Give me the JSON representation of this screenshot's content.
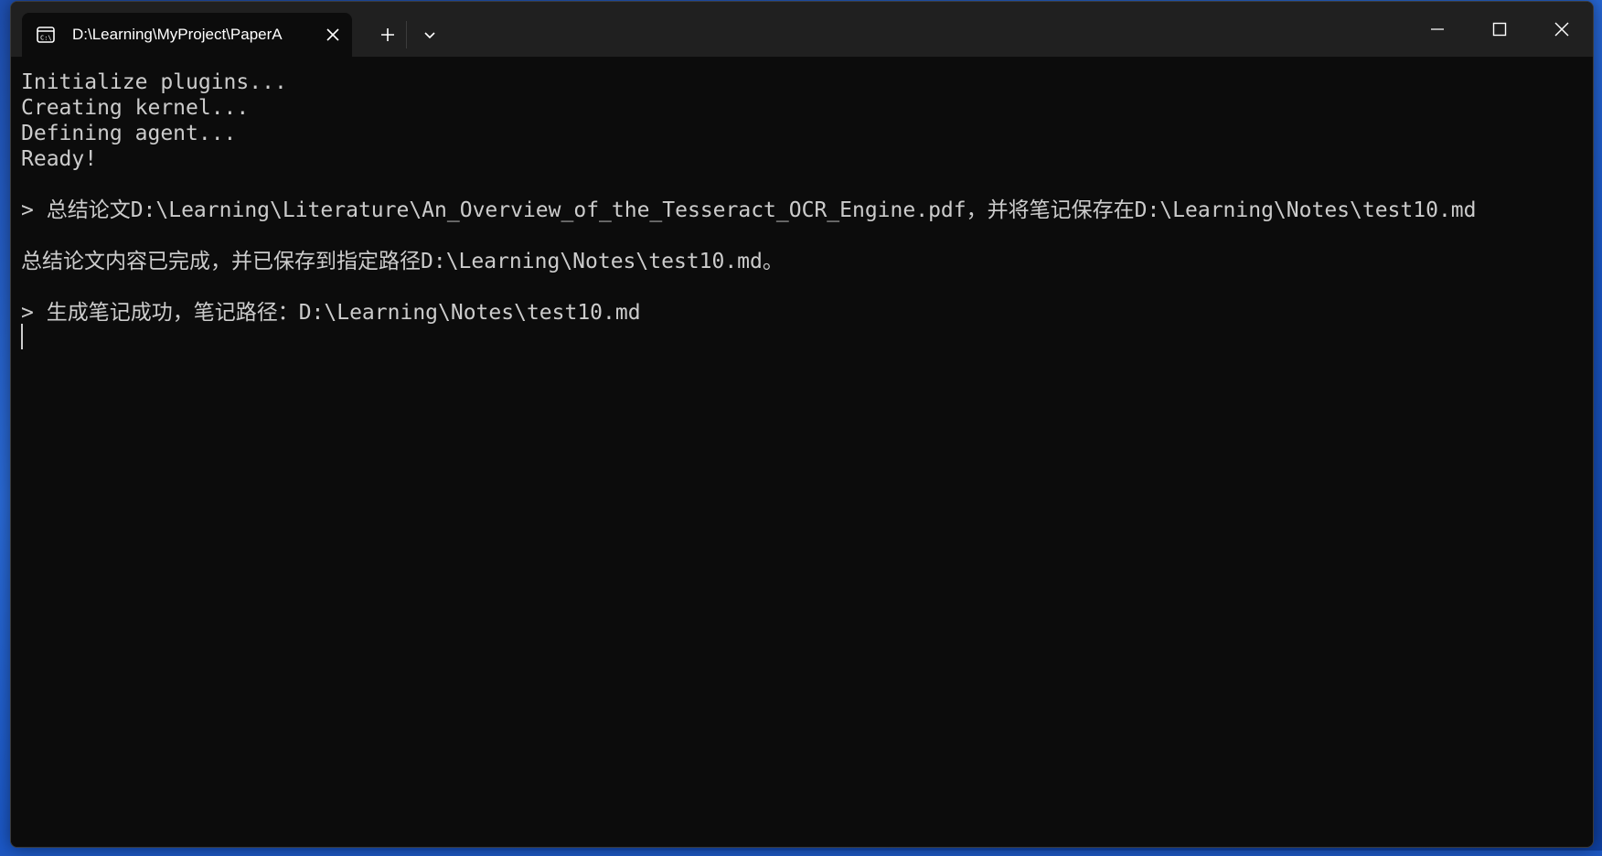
{
  "window": {
    "tab_title": "D:\\Learning\\MyProject\\PaperA",
    "icons": {
      "tab_icon": "terminal-cmd-icon",
      "tab_close": "close-icon",
      "new_tab": "plus-icon",
      "dropdown": "chevron-down-icon",
      "minimize": "minimize-icon",
      "maximize": "maximize-icon",
      "close": "close-icon"
    }
  },
  "terminal": {
    "lines": [
      "Initialize plugins...",
      "Creating kernel...",
      "Defining agent...",
      "Ready!",
      "",
      "> 总结论文D:\\Learning\\Literature\\An_Overview_of_the_Tesseract_OCR_Engine.pdf，并将笔记保存在D:\\Learning\\Notes\\test10.md",
      "",
      "总结论文内容已完成，并已保存到指定路径D:\\Learning\\Notes\\test10.md。",
      "",
      "> 生成笔记成功，笔记路径：D:\\Learning\\Notes\\test10.md"
    ]
  },
  "colors": {
    "terminal_background": "#0c0c0c",
    "titlebar_background": "#202020",
    "text": "#cccccc",
    "desktop_accent": "#1e4fb0"
  }
}
